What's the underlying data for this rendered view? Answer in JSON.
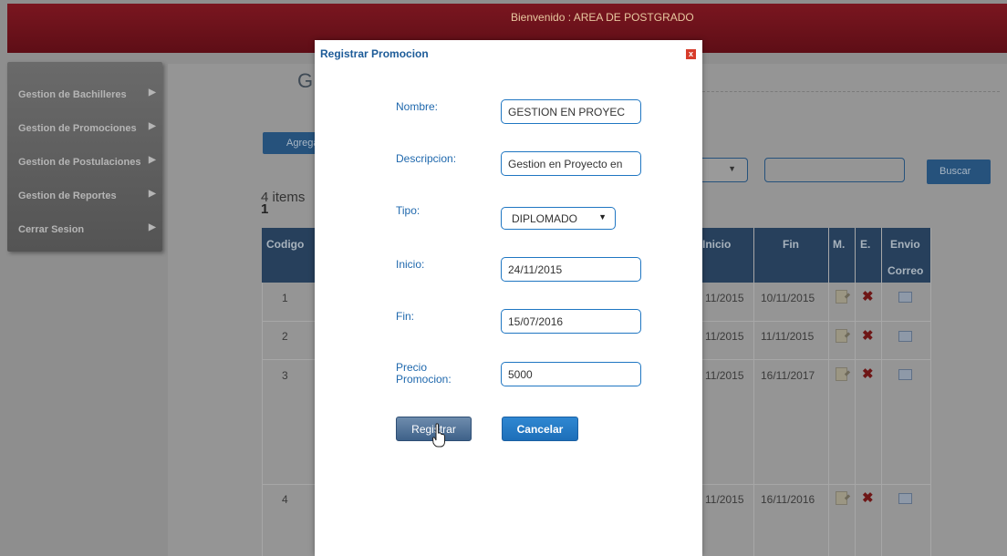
{
  "header": {
    "welcome": "Bienvenido : AREA DE POSTGRADO"
  },
  "sidebar": {
    "items": [
      {
        "label": "Gestion de Bachilleres"
      },
      {
        "label": "Gestion de Promociones"
      },
      {
        "label": "Gestion de Postulaciones"
      },
      {
        "label": "Gestion de Reportes"
      },
      {
        "label": "Cerrar Sesion"
      }
    ]
  },
  "main": {
    "title_partial": "G",
    "add_button_partial": "Agrega",
    "items_text": "4 items",
    "current_page": "1",
    "search_button": "Buscar",
    "table": {
      "headers": {
        "codigo": "Codigo",
        "inicio": "Inicio",
        "fin": "Fin",
        "m": "M.",
        "e": "E.",
        "envio1": "Envio",
        "envio2": "Correo"
      },
      "rows": [
        {
          "codigo": "1",
          "inicio": "11/2015",
          "fin": "10/11/2015"
        },
        {
          "codigo": "2",
          "inicio": "11/2015",
          "fin": "11/11/2015"
        },
        {
          "codigo": "3",
          "inicio": "11/2015",
          "fin": "16/11/2017"
        },
        {
          "codigo": "4",
          "inicio": "11/2015",
          "fin": "16/11/2016"
        }
      ]
    }
  },
  "modal": {
    "title": "Registrar Promocion",
    "close_glyph": "x",
    "fields": {
      "nombre": {
        "label": "Nombre:",
        "value": "GESTION EN PROYEC"
      },
      "descripcion": {
        "label": "Descripcion:",
        "value": "Gestion en Proyecto en"
      },
      "tipo": {
        "label": "Tipo:",
        "value": "DIPLOMADO"
      },
      "inicio": {
        "label": "Inicio:",
        "value": "24/11/2015"
      },
      "fin": {
        "label": "Fin:",
        "value": "15/07/2016"
      },
      "precio": {
        "label_line1": "Precio",
        "label_line2": "Promocion:",
        "value": "5000"
      }
    },
    "buttons": {
      "registrar": "Registrar",
      "cancelar": "Cancelar"
    }
  },
  "colors": {
    "header": "#6b1019",
    "modal_title": "#1c5b98",
    "primary_button": "#1d6fb9",
    "close": "#d73c2b"
  }
}
